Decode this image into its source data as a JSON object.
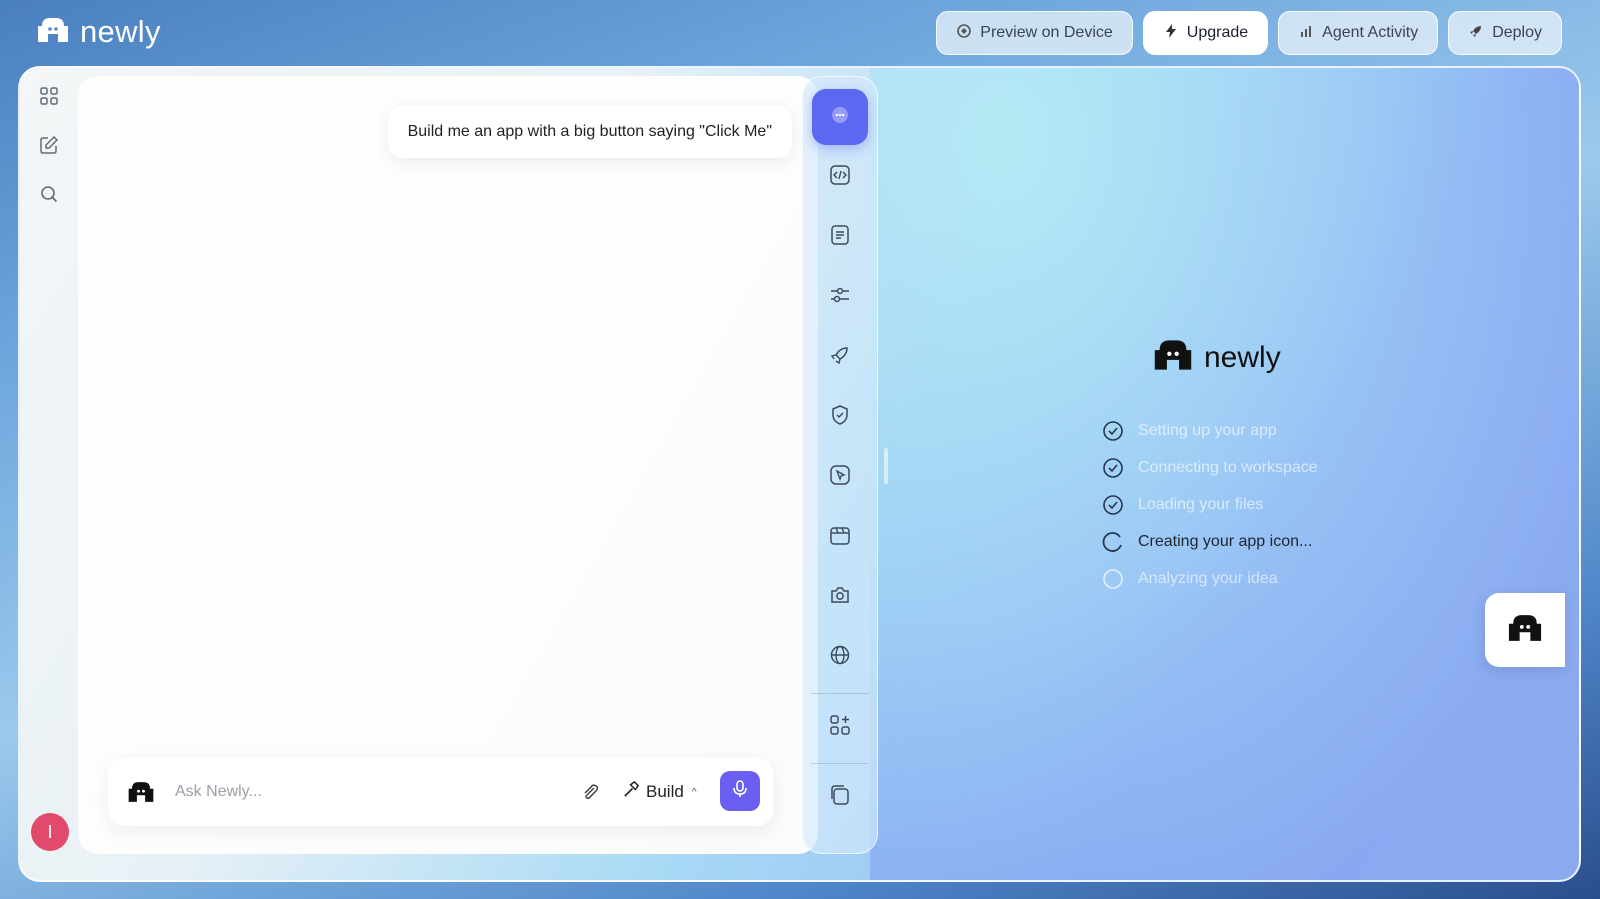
{
  "brand": {
    "name": "newly",
    "logo_icon": "newly-logo-icon"
  },
  "top_actions": [
    {
      "label": "Preview on Device",
      "icon": "device-preview-icon"
    },
    {
      "label": "Upgrade",
      "icon": "bolt-icon"
    },
    {
      "label": "Agent Activity",
      "icon": "bar-chart-icon"
    },
    {
      "label": "Deploy",
      "icon": "rocket-icon"
    }
  ],
  "left_rail": {
    "icons": [
      "grid-icon",
      "edit-icon",
      "search-icon"
    ],
    "avatar_initial": "I"
  },
  "chat": {
    "user_message": "Build me an app with a big button saying \"Click Me\"",
    "composer": {
      "placeholder": "Ask Newly...",
      "mode_label": "Build"
    }
  },
  "tool_rail": {
    "tools": [
      "chat-icon",
      "code-icon",
      "document-icon",
      "settings-sliders-icon",
      "rocket-icon",
      "shield-icon",
      "cursor-click-icon",
      "clapperboard-icon",
      "camera-icon",
      "globe-icon",
      "apps-add-icon",
      "copy-icon"
    ],
    "active": "chat-icon"
  },
  "status": {
    "brand_name": "newly",
    "steps": [
      {
        "label": "Setting up your app",
        "state": "done"
      },
      {
        "label": "Connecting to workspace",
        "state": "done"
      },
      {
        "label": "Loading your files",
        "state": "done"
      },
      {
        "label": "Creating your app icon...",
        "state": "active"
      },
      {
        "label": "Analyzing your idea",
        "state": "pending"
      }
    ]
  },
  "colors": {
    "accent": "#5c68f0",
    "mic": "#6a5ff0",
    "avatar": "#e14a6b"
  }
}
